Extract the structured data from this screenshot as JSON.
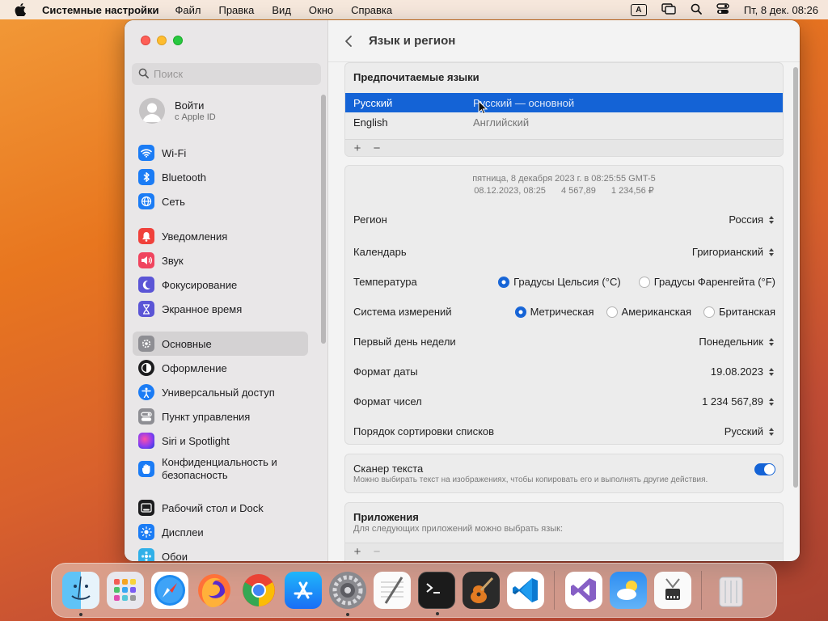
{
  "menubar": {
    "app_name": "Системные настройки",
    "menus": [
      "Файл",
      "Правка",
      "Вид",
      "Окно",
      "Справка"
    ],
    "input_source": "A",
    "clock": "Пт, 8 дек.  08:26"
  },
  "sidebar": {
    "search_placeholder": "Поиск",
    "account": {
      "name": "Войти",
      "sub": "с Apple ID"
    },
    "items": [
      {
        "label": "Wi-Fi",
        "icon": "wifi-icon",
        "color": "#1b7cf5"
      },
      {
        "label": "Bluetooth",
        "icon": "bluetooth-icon",
        "color": "#1b7cf5"
      },
      {
        "label": "Сеть",
        "icon": "globe-icon",
        "color": "#1b7cf5"
      },
      {
        "label": "Уведомления",
        "icon": "bell-icon",
        "color": "#f0413b"
      },
      {
        "label": "Звук",
        "icon": "speaker-icon",
        "color": "#f0445e"
      },
      {
        "label": "Фокусирование",
        "icon": "moon-icon",
        "color": "#5b55d6"
      },
      {
        "label": "Экранное время",
        "icon": "hourglass-icon",
        "color": "#5b55d6"
      },
      {
        "label": "Основные",
        "icon": "gear-icon",
        "color": "#8e8e93"
      },
      {
        "label": "Оформление",
        "icon": "appearance-icon",
        "color": "#1c1c1e"
      },
      {
        "label": "Универсальный доступ",
        "icon": "accessibility-icon",
        "color": "#1b7cf5"
      },
      {
        "label": "Пункт управления",
        "icon": "control-center-icon",
        "color": "#8e8e93"
      },
      {
        "label": "Siri и Spotlight",
        "icon": "siri-icon",
        "color": "#8a3df0"
      },
      {
        "label": "Конфиденциальность и безопасность",
        "icon": "privacy-hand-icon",
        "color": "#1b7cf5"
      },
      {
        "label": "Рабочий стол и Dock",
        "icon": "desktop-dock-icon",
        "color": "#1c1c1e"
      },
      {
        "label": "Дисплеи",
        "icon": "display-icon",
        "color": "#1b7cf5"
      },
      {
        "label": "Обои",
        "icon": "wallpaper-icon",
        "color": "#30b0e8"
      }
    ]
  },
  "content": {
    "title": "Язык и регион",
    "preferred_languages": {
      "title": "Предпочитаемые языки",
      "rows": [
        {
          "name": "Русский",
          "desc": "Русский — основной"
        },
        {
          "name": "English",
          "desc": "Английский"
        }
      ],
      "add": "+",
      "remove": "−"
    },
    "preview": {
      "line1": "пятница, 8 декабря 2023 г. в 08:25:55 GMT-5",
      "date": "08.12.2023, 08:25",
      "number": "4 567,89",
      "currency": "1 234,56 ₽"
    },
    "settings": {
      "region": {
        "label": "Регион",
        "value": "Россия"
      },
      "calendar": {
        "label": "Календарь",
        "value": "Григорианский"
      },
      "temperature": {
        "label": "Температура",
        "options": [
          "Градусы Цельсия (°C)",
          "Градусы Фаренгейта (°F)"
        ],
        "selected": 0
      },
      "measurement": {
        "label": "Система измерений",
        "options": [
          "Метрическая",
          "Американская",
          "Британская"
        ],
        "selected": 0
      },
      "first_day": {
        "label": "Первый день недели",
        "value": "Понедельник"
      },
      "date_format": {
        "label": "Формат даты",
        "value": "19.08.2023"
      },
      "number_format": {
        "label": "Формат чисел",
        "value": "1 234 567,89"
      },
      "sort_order": {
        "label": "Порядок сортировки списков",
        "value": "Русский"
      }
    },
    "live_text": {
      "label": "Сканер текста",
      "desc": "Можно выбирать текст на изображениях, чтобы копировать его и выполнять другие действия.",
      "enabled": true
    },
    "apps": {
      "title": "Приложения",
      "desc": "Для следующих приложений можно выбрать язык:",
      "add": "+",
      "remove": "−"
    }
  },
  "dock": {
    "apps": [
      "Finder",
      "Launchpad",
      "Safari",
      "Firefox",
      "Chrome",
      "App Store",
      "Системные настройки",
      "TextEdit",
      "Терминал",
      "GarageBand",
      "Visual Studio Code",
      "Visual Studio",
      "Погода",
      "Утилита"
    ],
    "trash": "Корзина"
  },
  "colors": {
    "accent": "#1463d6",
    "selection": "#1463d6"
  }
}
